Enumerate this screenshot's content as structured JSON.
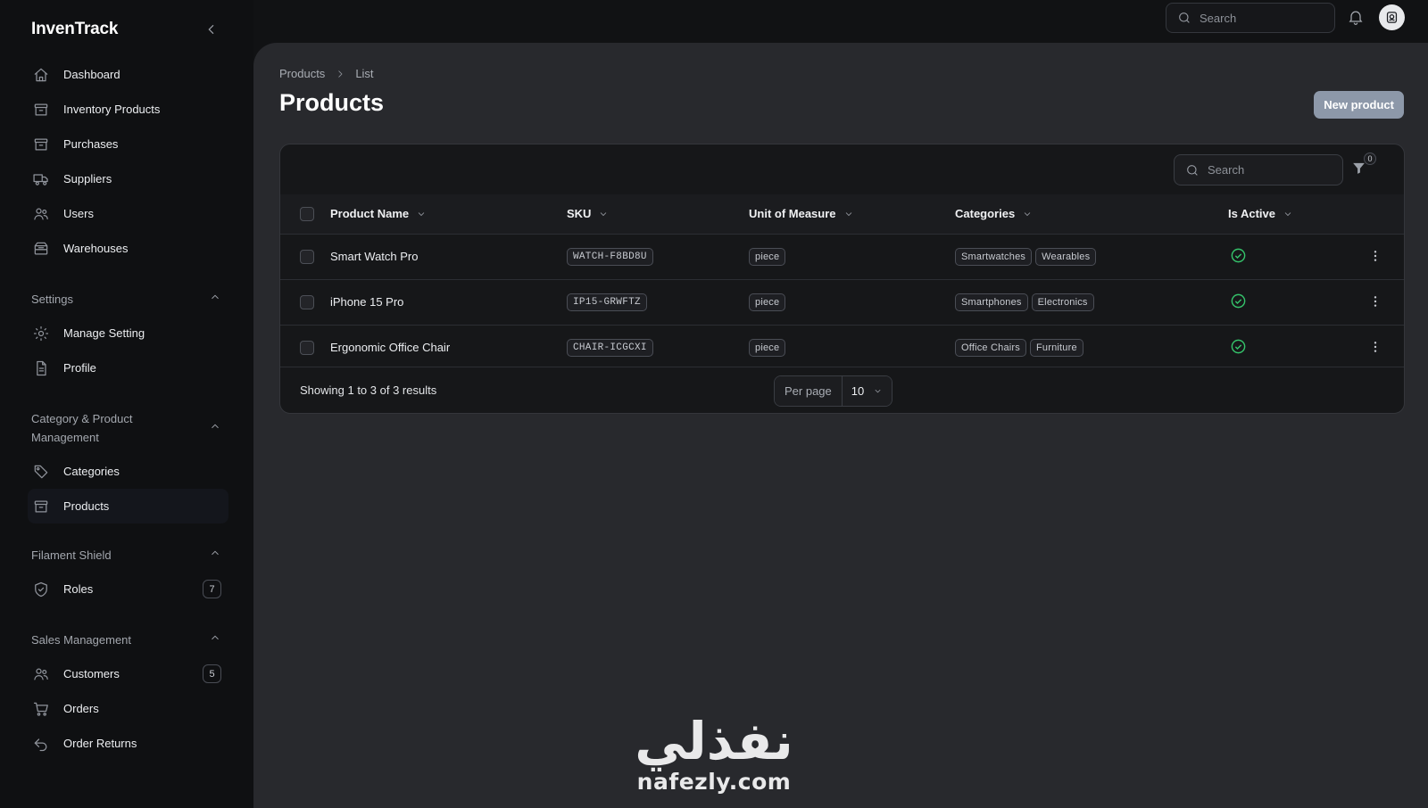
{
  "app": {
    "name": "InvenTrack"
  },
  "sidebar": {
    "primary": [
      {
        "label": "Dashboard",
        "icon": "home-icon"
      },
      {
        "label": "Inventory Products",
        "icon": "archive-box-icon"
      },
      {
        "label": "Purchases",
        "icon": "archive-box-icon"
      },
      {
        "label": "Suppliers",
        "icon": "truck-icon"
      },
      {
        "label": "Users",
        "icon": "users-icon"
      },
      {
        "label": "Warehouses",
        "icon": "inbox-stack-icon"
      }
    ],
    "groups": [
      {
        "title": "Settings",
        "items": [
          {
            "label": "Manage Setting",
            "icon": "gear-icon"
          },
          {
            "label": "Profile",
            "icon": "document-icon"
          }
        ]
      },
      {
        "title": "Category & Product Management",
        "items": [
          {
            "label": "Categories",
            "icon": "tag-icon"
          },
          {
            "label": "Products",
            "icon": "archive-box-icon",
            "active": true
          }
        ]
      },
      {
        "title": "Filament Shield",
        "items": [
          {
            "label": "Roles",
            "icon": "shield-check-icon",
            "badge": "7"
          }
        ]
      },
      {
        "title": "Sales Management",
        "items": [
          {
            "label": "Customers",
            "icon": "users-icon",
            "badge": "5"
          },
          {
            "label": "Orders",
            "icon": "cart-icon"
          },
          {
            "label": "Order Returns",
            "icon": "return-arrow-icon"
          }
        ]
      }
    ]
  },
  "topbar": {
    "search_placeholder": "Search"
  },
  "page": {
    "breadcrumb": [
      "Products",
      "List"
    ],
    "title": "Products",
    "new_button": "New product"
  },
  "table": {
    "search_placeholder": "Search",
    "filter_count": "0",
    "columns": [
      "Product Name",
      "SKU",
      "Unit of Measure",
      "Categories",
      "Is Active"
    ],
    "rows": [
      {
        "name": "Smart Watch Pro",
        "sku": "WATCH-F8BD8U",
        "uom": "piece",
        "categories": [
          "Smartwatches",
          "Wearables"
        ],
        "active": true
      },
      {
        "name": "iPhone 15 Pro",
        "sku": "IP15-GRWFTZ",
        "uom": "piece",
        "categories": [
          "Smartphones",
          "Electronics"
        ],
        "active": true
      },
      {
        "name": "Ergonomic Office Chair",
        "sku": "CHAIR-ICGCXI",
        "uom": "piece",
        "categories": [
          "Office Chairs",
          "Furniture"
        ],
        "active": true
      }
    ],
    "showing": "Showing 1 to 3 of 3 results",
    "per_page_label": "Per page",
    "per_page_value": "10"
  },
  "watermark": {
    "arabic": "نفذلي",
    "latin": "nafezly.com"
  },
  "colors": {
    "accent_button": "#8d98a9",
    "active_check": "#35c46b",
    "panel": "#28292d",
    "sidebar": "#0f1012"
  }
}
